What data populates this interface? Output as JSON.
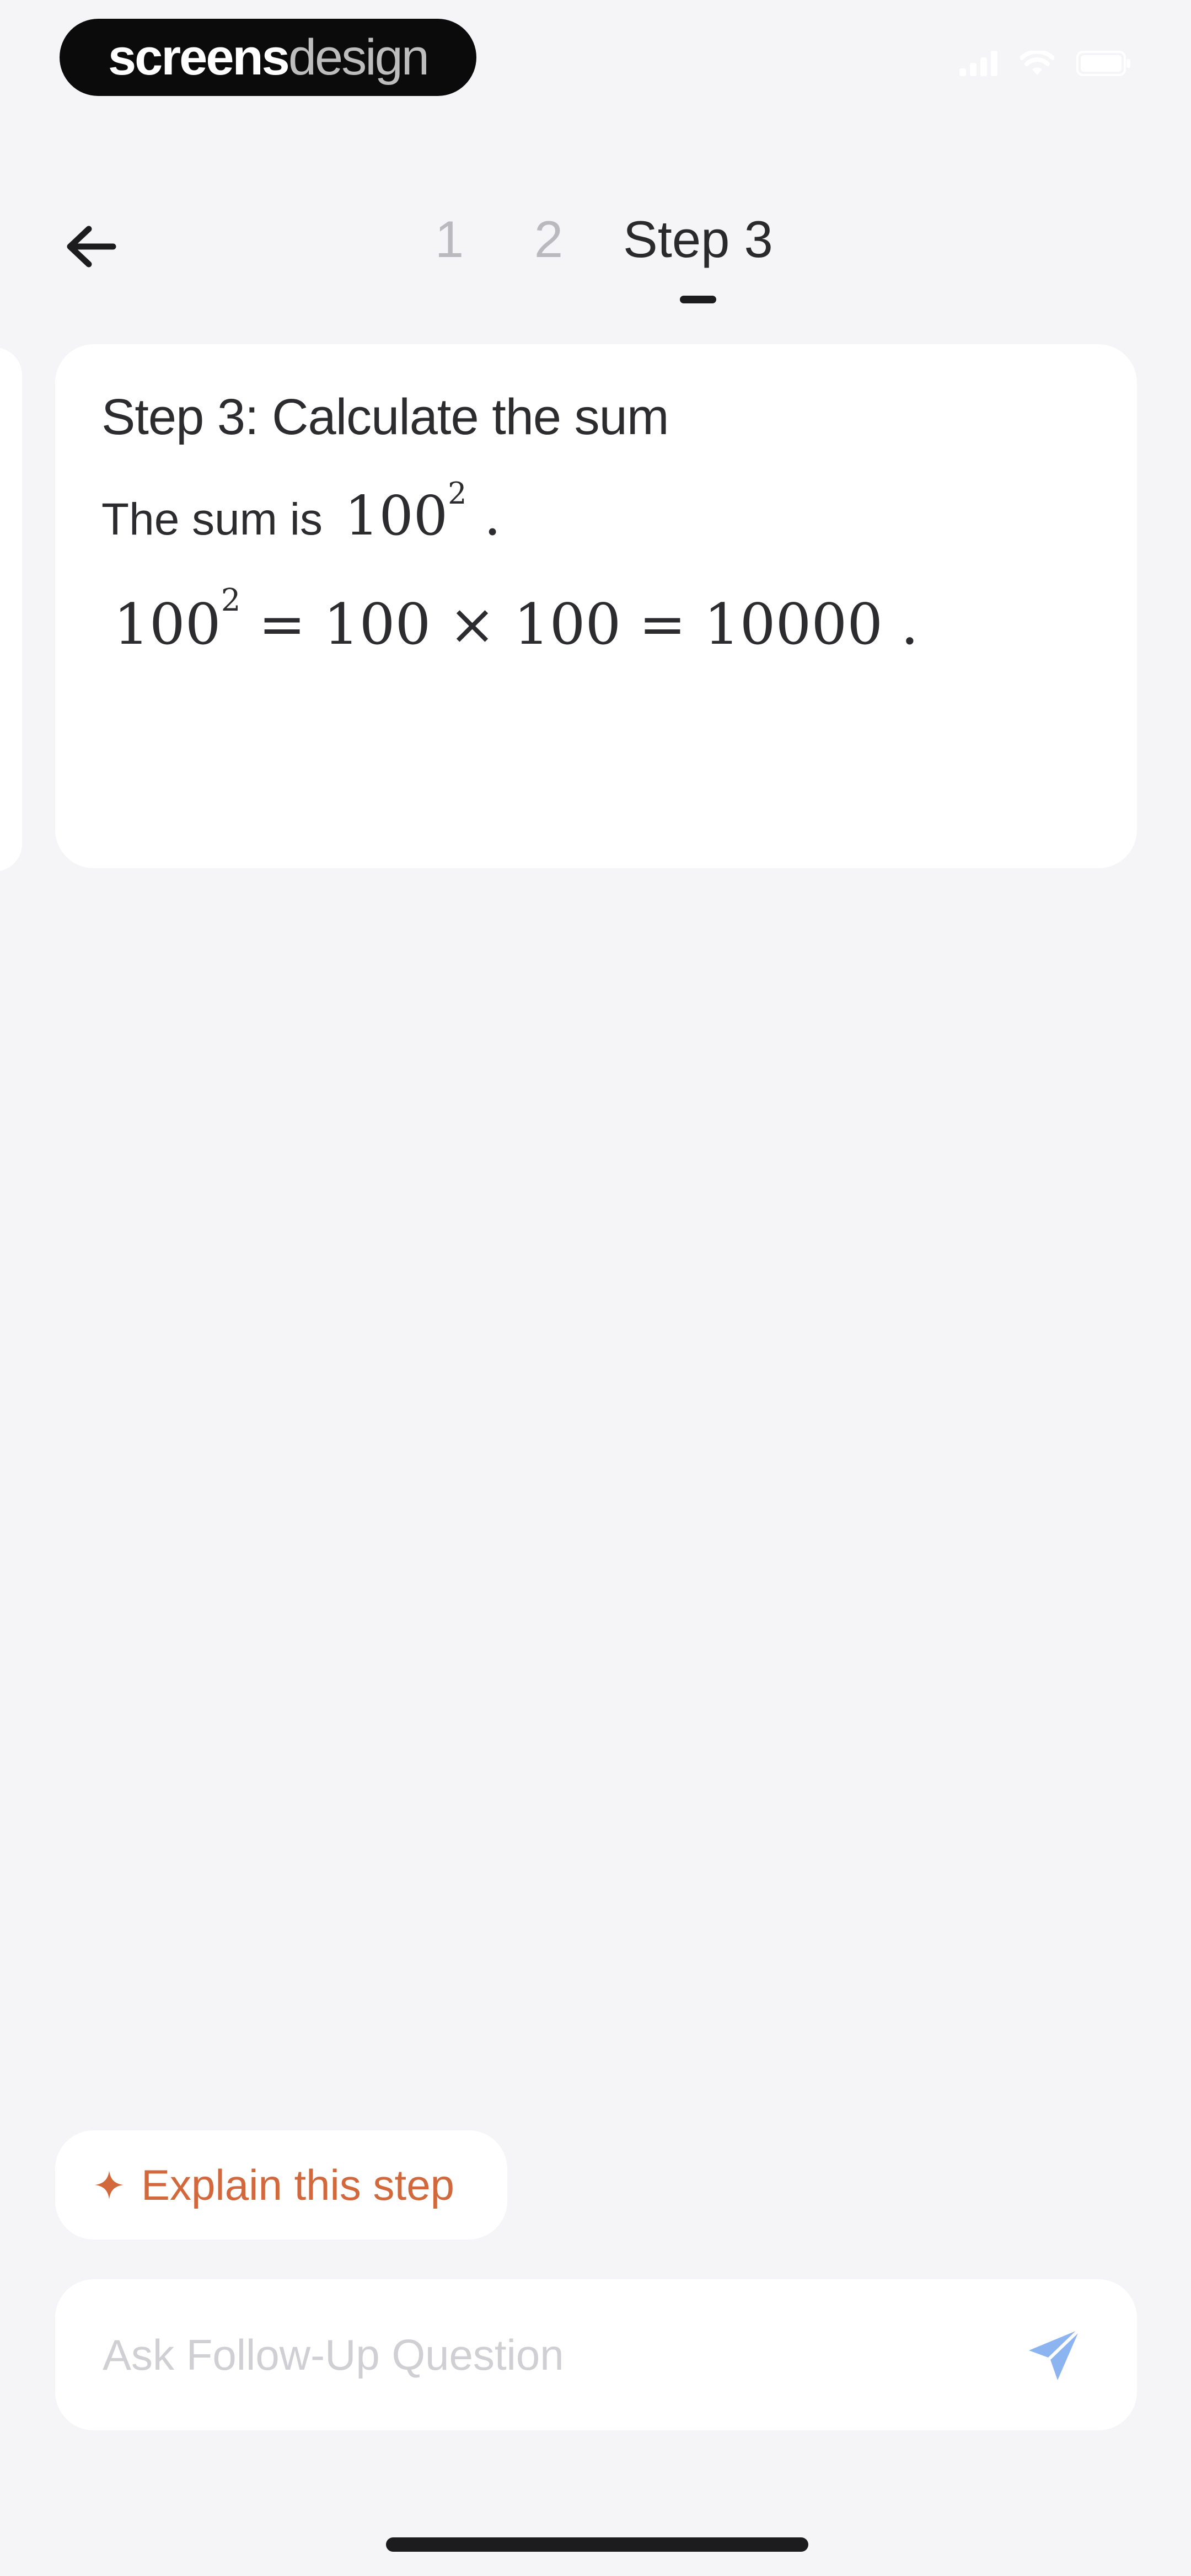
{
  "status_bar": {
    "brand_bold": "screens",
    "brand_light": "design",
    "icons": [
      "cellular-signal-icon",
      "wifi-icon",
      "battery-icon"
    ]
  },
  "nav": {
    "back_icon": "arrow-left-icon",
    "tabs": [
      {
        "label": "1",
        "active": false
      },
      {
        "label": "2",
        "active": false
      },
      {
        "label": "Step 3",
        "active": true
      }
    ]
  },
  "step": {
    "title": "Step 3: Calculate the sum",
    "sentence_prefix": "The sum is",
    "sentence_base": "100",
    "sentence_exp": "2",
    "sentence_suffix": ".",
    "eq_base": "100",
    "eq_exp": "2",
    "eq_rest": " = 100 × 100 = 10000 ."
  },
  "actions": {
    "explain_icon": "sparkle-icon",
    "explain_label": "Explain this step",
    "ask_placeholder": "Ask Follow-Up Question",
    "ask_value": "",
    "send_icon": "send-icon"
  },
  "colors": {
    "background": "#f5f5f7",
    "card": "#ffffff",
    "accent_orange": "#d2693d",
    "send_blue": "#8cb4f0"
  }
}
